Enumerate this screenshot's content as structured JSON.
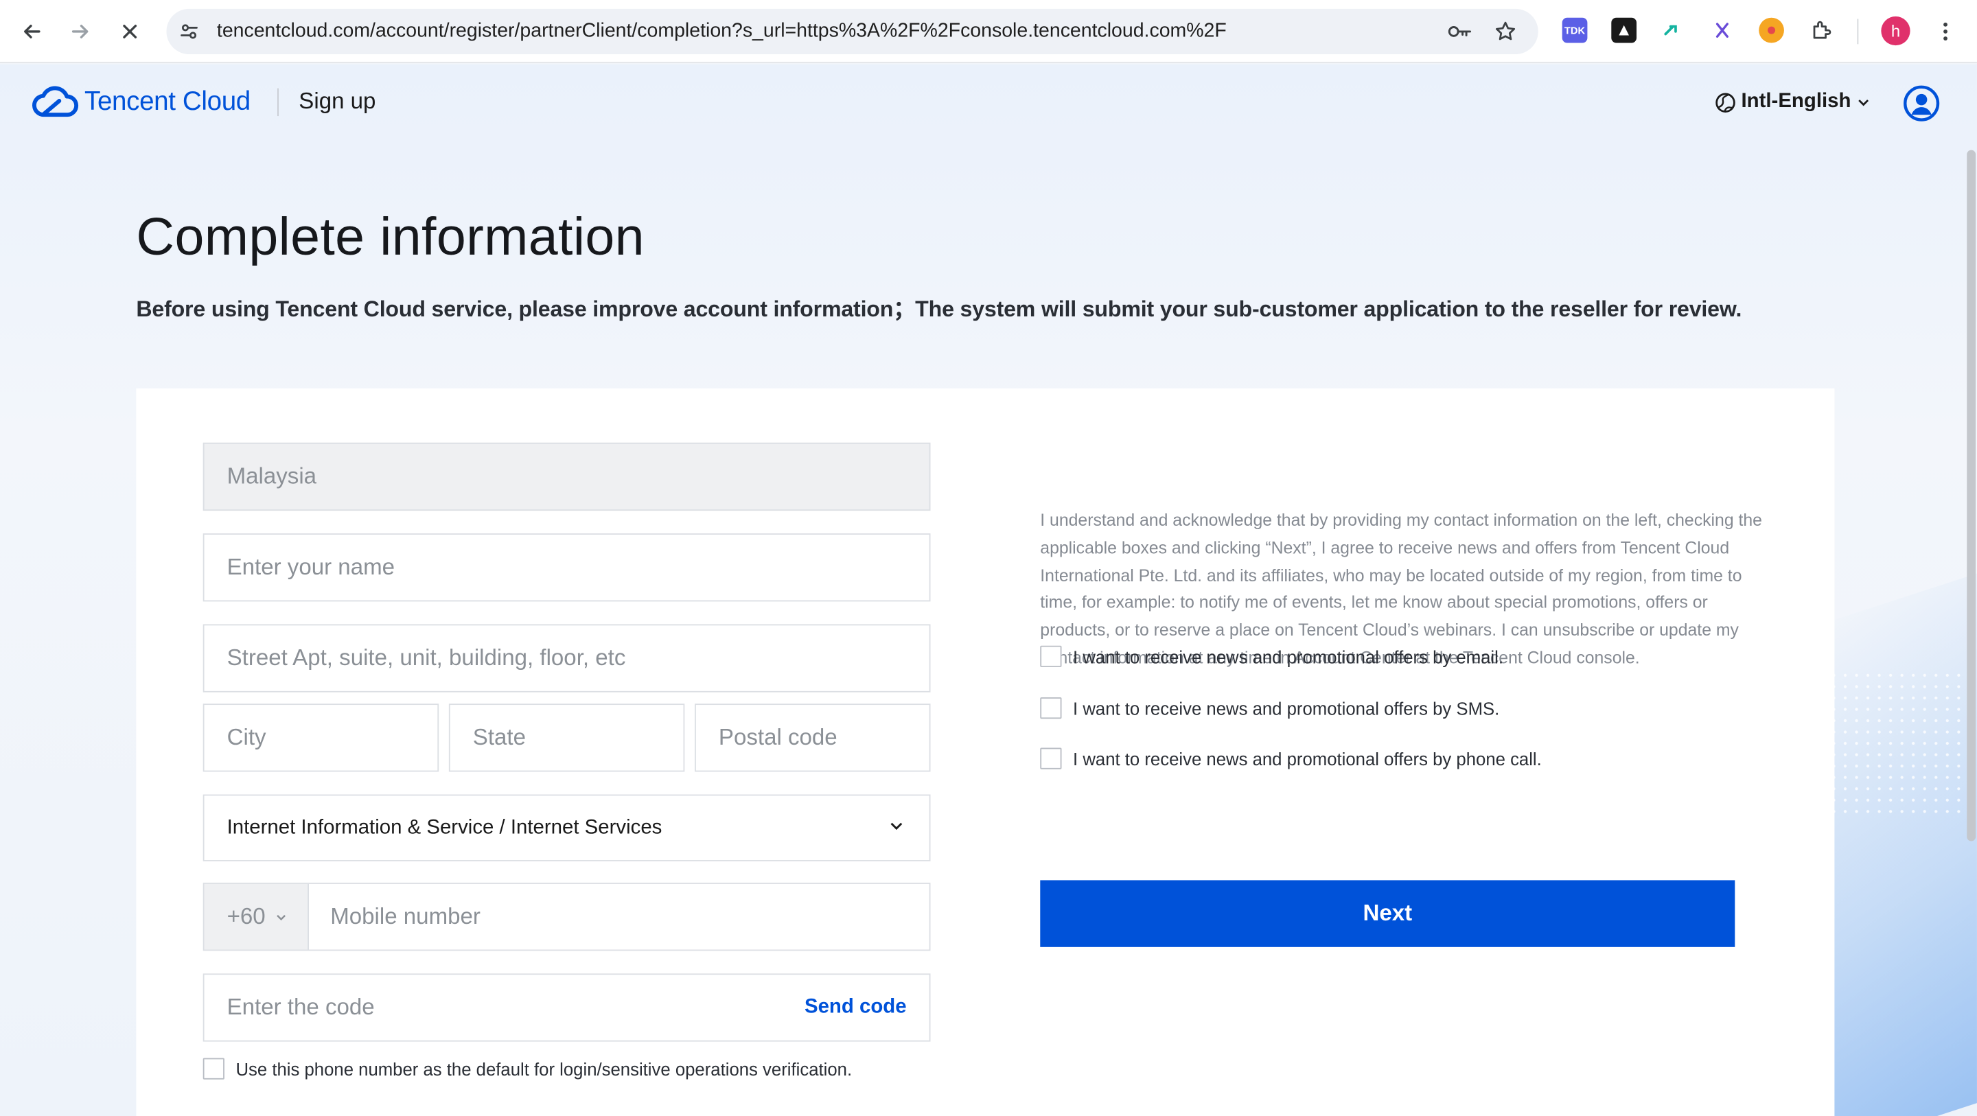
{
  "browser": {
    "url": "tencentcloud.com/account/register/partnerClient/completion?s_url=https%3A%2F%2Fconsole.tencentcloud.com%2F",
    "profile_initial": "h",
    "extension_tdk_label": "TDK"
  },
  "header": {
    "brand": "Tencent Cloud",
    "page_label": "Sign up",
    "language": "Intl-English"
  },
  "main": {
    "title": "Complete information",
    "subtitle": "Before using Tencent Cloud service, please improve account information；The system will submit your sub-customer application to the reseller for review."
  },
  "form": {
    "country_value": "Malaysia",
    "name_placeholder": "Enter your name",
    "street_placeholder": "Street Apt, suite, unit, building, floor, etc",
    "city_placeholder": "City",
    "state_placeholder": "State",
    "postal_placeholder": "Postal code",
    "industry_value": "Internet Information & Service / Internet Services",
    "country_code": "+60",
    "mobile_placeholder": "Mobile number",
    "code_placeholder": "Enter the code",
    "send_code_label": "Send code",
    "default_phone_label": "Use this phone number as the default for login/sensitive operations verification."
  },
  "consent": {
    "text": "I understand and acknowledge that by providing my contact information on the left, checking the applicable boxes and clicking “Next”, I agree to receive news and offers from Tencent Cloud International Pte. Ltd. and its affiliates, who may be located outside of my region, from time to time, for example: to notify me of events, let me know about special promotions, offers or products, or to reserve a place on Tencent Cloud’s webinars. I can unsubscribe or update my contact information at any time in Account Center at the Tencent Cloud console.",
    "options": [
      "I want to receive news and promotional offers by email.",
      "I want to receive news and promotional offers by SMS.",
      "I want to receive news and promotional offers by phone call."
    ],
    "next_label": "Next"
  },
  "colors": {
    "brand": "#0052d9",
    "page_background": "#eaf1fb"
  }
}
